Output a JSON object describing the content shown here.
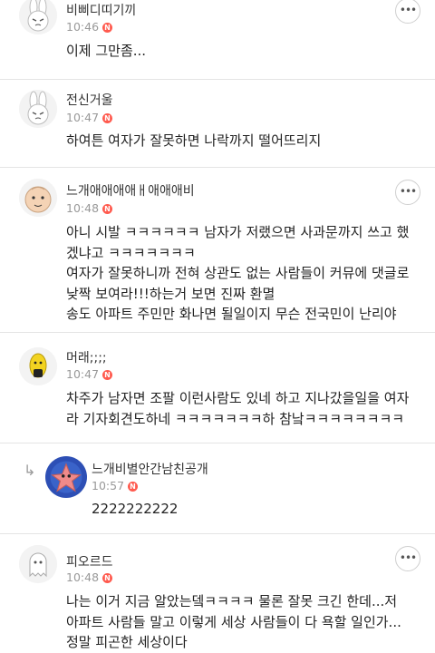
{
  "comments": [
    {
      "name": "비삐디띠기끼",
      "time": "10:46",
      "badge": "N",
      "icon": "bunny-avatar-icon",
      "lines": [
        "이제 그만좀..."
      ]
    },
    {
      "name": "전신거울",
      "time": "10:47",
      "badge": "N",
      "icon": "bunny-avatar-icon",
      "lines": [
        "하여튼 여자가 잘못하면 나락까지 떨어뜨리지"
      ]
    },
    {
      "name": "느개애애애애ㅐ애애애비",
      "time": "10:48",
      "badge": "N",
      "icon": "peach-avatar-icon",
      "lines": [
        "아니 시발 ㅋㅋㅋㅋㅋㅋ 남자가 저랬으면 사과문까지 쓰고 했",
        "겠냐고 ㅋㅋㅋㅋㅋㅋㅋ",
        "여자가 잘못하니까 전혀 상관도 없는 사람들이 커뮤에 댓글로",
        "낮짝 보여라!!!하는거 보면 진짜 환멸",
        "송도 아파트 주민만 화나면 될일이지 무슨 전국민이 난리야"
      ]
    },
    {
      "name": "머래;;;;",
      "time": "10:47",
      "badge": "N",
      "icon": "lemon-avatar-icon",
      "lines": [
        "차주가 남자면 조팔 이런사람도 있네 하고 지나갔을일을 여자",
        "라 기자회견도하네 ㅋㅋㅋㅋㅋㅋㅋ하 참낰ㅋㅋㅋㅋㅋㅋㅋㅋ"
      ]
    },
    {
      "name": "느개비별안간남친공개",
      "time": "10:57",
      "badge": "N",
      "icon": "starfish-avatar-icon",
      "reply_icon": "reply-arrow-icon",
      "lines": [
        "2222222222"
      ]
    },
    {
      "name": "피오르드",
      "time": "10:48",
      "badge": "N",
      "icon": "ghost-avatar-icon",
      "lines": [
        "나는 이거 지금 알았는뎈ㅋㅋㅋㅋ 물론 잘못 크긴 한데...저",
        "아파트 사람들 말고 이렇게 세상 사람들이 다 욕할 일인가...",
        "정말 피곤한 세상이다"
      ]
    }
  ],
  "more_label": "•••"
}
